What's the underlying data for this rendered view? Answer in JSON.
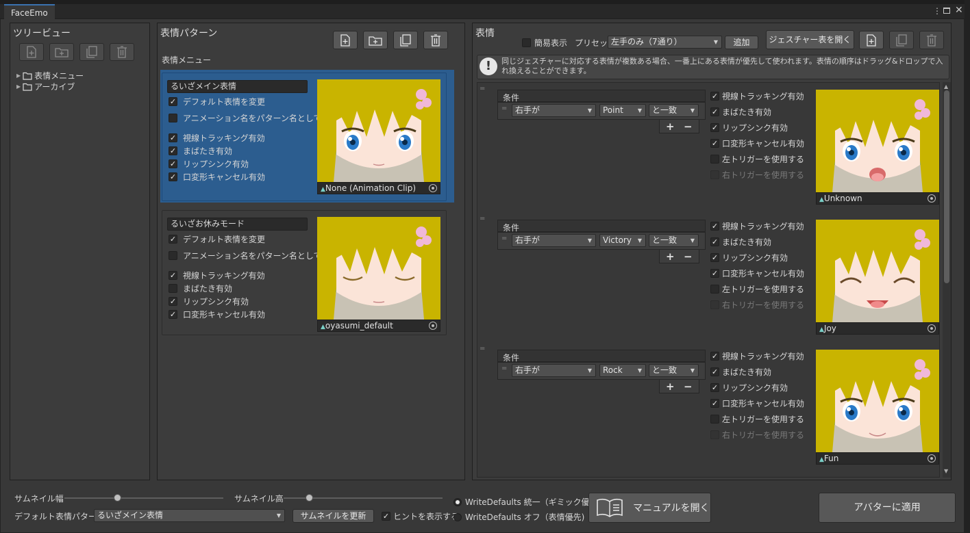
{
  "window": {
    "tab_title": "FaceEmo",
    "menu_icon": "kebab-menu-icon",
    "maximize_icon": "maximize-icon",
    "close_icon": "close-icon"
  },
  "tree": {
    "title": "ツリービュー",
    "items": [
      {
        "label": "表情メニュー",
        "icon": "folder-icon"
      },
      {
        "label": "アーカイブ",
        "icon": "folder-icon"
      }
    ]
  },
  "patterns": {
    "title": "表情パターン",
    "menu_label": "表情メニュー",
    "cards": [
      {
        "name": "るいざメイン表情",
        "selected": true,
        "options": [
          {
            "label": "デフォルト表情を変更",
            "checked": true
          },
          {
            "label": "アニメーション名をパターン名として使用",
            "checked": false
          },
          {
            "label": "視線トラッキング有効",
            "checked": true
          },
          {
            "label": "まばたき有効",
            "checked": true
          },
          {
            "label": "リップシンク有効",
            "checked": true
          },
          {
            "label": "口変形キャンセル有効",
            "checked": true
          }
        ],
        "clip": "None (Animation Clip)",
        "expression": "neutral"
      },
      {
        "name": "るいざお休みモード",
        "selected": false,
        "options": [
          {
            "label": "デフォルト表情を変更",
            "checked": true
          },
          {
            "label": "アニメーション名をパターン名として使用",
            "checked": false
          },
          {
            "label": "視線トラッキング有効",
            "checked": true
          },
          {
            "label": "まばたき有効",
            "checked": false
          },
          {
            "label": "リップシンク有効",
            "checked": true
          },
          {
            "label": "口変形キャンセル有効",
            "checked": true
          }
        ],
        "clip": "oyasumi_default",
        "expression": "sleep"
      }
    ]
  },
  "expressions": {
    "title": "表情",
    "simple_label": "簡易表示",
    "preset_label": "プリセット",
    "preset_value": "左手のみ（7通り）",
    "add_label": "追加",
    "open_gesture_label": "ジェスチャー表を開く",
    "info": "同じジェスチャーに対応する表情が複数ある場合、一番上にある表情が優先して使われます。表情の順序はドラッグ&ドロップで入れ換えることができます。",
    "condition_label": "条件",
    "items": [
      {
        "hand": "右手が",
        "gesture": "Point",
        "match": "と一致",
        "options": [
          {
            "label": "視線トラッキング有効",
            "checked": true
          },
          {
            "label": "まばたき有効",
            "checked": true
          },
          {
            "label": "リップシンク有効",
            "checked": true
          },
          {
            "label": "口変形キャンセル有効",
            "checked": true
          },
          {
            "label": "左トリガーを使用する",
            "checked": false
          },
          {
            "label": "右トリガーを使用する",
            "checked": false,
            "disabled": true
          }
        ],
        "clip": "Unknown",
        "expression": "tongue"
      },
      {
        "hand": "右手が",
        "gesture": "Victory",
        "match": "と一致",
        "options": [
          {
            "label": "視線トラッキング有効",
            "checked": true
          },
          {
            "label": "まばたき有効",
            "checked": true
          },
          {
            "label": "リップシンク有効",
            "checked": true
          },
          {
            "label": "口変形キャンセル有効",
            "checked": true
          },
          {
            "label": "左トリガーを使用する",
            "checked": false
          },
          {
            "label": "右トリガーを使用する",
            "checked": false,
            "disabled": true
          }
        ],
        "clip": "Joy",
        "expression": "joy"
      },
      {
        "hand": "右手が",
        "gesture": "Rock",
        "match": "と一致",
        "options": [
          {
            "label": "視線トラッキング有効",
            "checked": true
          },
          {
            "label": "まばたき有効",
            "checked": true
          },
          {
            "label": "リップシンク有効",
            "checked": true
          },
          {
            "label": "口変形キャンセル有効",
            "checked": true
          },
          {
            "label": "左トリガーを使用する",
            "checked": false
          },
          {
            "label": "右トリガーを使用する",
            "checked": false,
            "disabled": true
          }
        ],
        "clip": "Fun",
        "expression": "fun"
      }
    ]
  },
  "footer": {
    "thumb_width_label": "サムネイル幅",
    "thumb_width_value": 0.33,
    "thumb_height_label": "サムネイル高",
    "thumb_height_value": 0.16,
    "default_pattern_label": "デフォルト表情パターン",
    "default_pattern_value": "るいざメイン表情",
    "refresh_thumb_label": "サムネイルを更新",
    "show_hints_label": "ヒントを表示する",
    "show_hints_checked": true,
    "wd_on_label": "WriteDefaults 統一（ギミック優先)",
    "wd_off_label": "WriteDefaults オフ（表情優先)",
    "wd_selected": "on",
    "manual_label": "マニュアルを開く",
    "apply_label": "アバターに適用"
  },
  "colors": {
    "selected_card": "#2c5d8f",
    "hair": "#c9b400",
    "accent": "#3a72b0"
  }
}
